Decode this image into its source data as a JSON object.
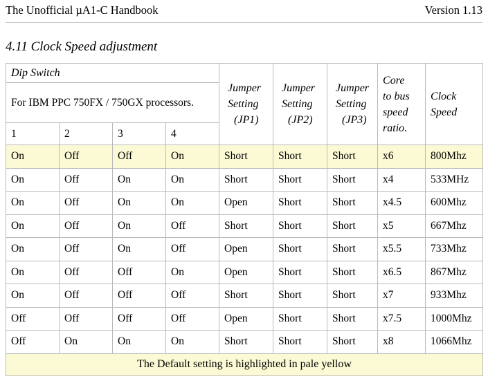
{
  "header": {
    "title": "The Unofficial µA1-C Handbook",
    "version": "Version 1.13"
  },
  "section": {
    "heading": "4.11 Clock Speed adjustment"
  },
  "table": {
    "group_header": "Dip Switch",
    "note": "For IBM PPC 750FX / 750GX processors.",
    "dip_numbers": [
      "1",
      "2",
      "3",
      "4"
    ],
    "jp1": {
      "line1": "Jumper",
      "line2": "Setting",
      "line3": "(JP1)"
    },
    "jp2": {
      "line1": "Jumper",
      "line2": "Setting",
      "line3": "(JP2)"
    },
    "jp3": {
      "line1": "Jumper",
      "line2": "Setting",
      "line3": "(JP3)"
    },
    "ratio": {
      "line1": "Core",
      "line2": "to bus",
      "line3": "speed",
      "line4": "ratio."
    },
    "clock": {
      "line1": "Clock",
      "line2": "Speed"
    },
    "highlight_color": "#fbfad5",
    "footer_note": "The Default setting is highlighted in pale yellow",
    "rows": [
      {
        "highlighted": true,
        "dip1": "On",
        "dip2": "Off",
        "dip3": "Off",
        "dip4": "On",
        "jp1": "Short",
        "jp2": "Short",
        "jp3": "Short",
        "ratio": "x6",
        "clock": "800Mhz"
      },
      {
        "highlighted": false,
        "dip1": "On",
        "dip2": "Off",
        "dip3": "On",
        "dip4": "On",
        "jp1": "Short",
        "jp2": "Short",
        "jp3": "Short",
        "ratio": "x4",
        "clock": "533MHz"
      },
      {
        "highlighted": false,
        "dip1": "On",
        "dip2": "Off",
        "dip3": "On",
        "dip4": "On",
        "jp1": "Open",
        "jp2": "Short",
        "jp3": "Short",
        "ratio": "x4.5",
        "clock": "600Mhz"
      },
      {
        "highlighted": false,
        "dip1": "On",
        "dip2": "Off",
        "dip3": "On",
        "dip4": "Off",
        "jp1": "Short",
        "jp2": "Short",
        "jp3": "Short",
        "ratio": "x5",
        "clock": "667Mhz"
      },
      {
        "highlighted": false,
        "dip1": "On",
        "dip2": "Off",
        "dip3": "On",
        "dip4": "Off",
        "jp1": "Open",
        "jp2": "Short",
        "jp3": "Short",
        "ratio": "x5.5",
        "clock": "733Mhz"
      },
      {
        "highlighted": false,
        "dip1": "On",
        "dip2": "Off",
        "dip3": "Off",
        "dip4": "On",
        "jp1": "Open",
        "jp2": "Short",
        "jp3": "Short",
        "ratio": "x6.5",
        "clock": "867Mhz"
      },
      {
        "highlighted": false,
        "dip1": "On",
        "dip2": "Off",
        "dip3": "Off",
        "dip4": "Off",
        "jp1": "Short",
        "jp2": "Short",
        "jp3": "Short",
        "ratio": "x7",
        "clock": "933Mhz"
      },
      {
        "highlighted": false,
        "dip1": "Off",
        "dip2": "Off",
        "dip3": "Off",
        "dip4": "Off",
        "jp1": "Open",
        "jp2": "Short",
        "jp3": "Short",
        "ratio": "x7.5",
        "clock": "1000Mhz"
      },
      {
        "highlighted": false,
        "dip1": "Off",
        "dip2": "On",
        "dip3": "On",
        "dip4": "On",
        "jp1": "Short",
        "jp2": "Short",
        "jp3": "Short",
        "ratio": "x8",
        "clock": "1066Mhz"
      }
    ]
  }
}
